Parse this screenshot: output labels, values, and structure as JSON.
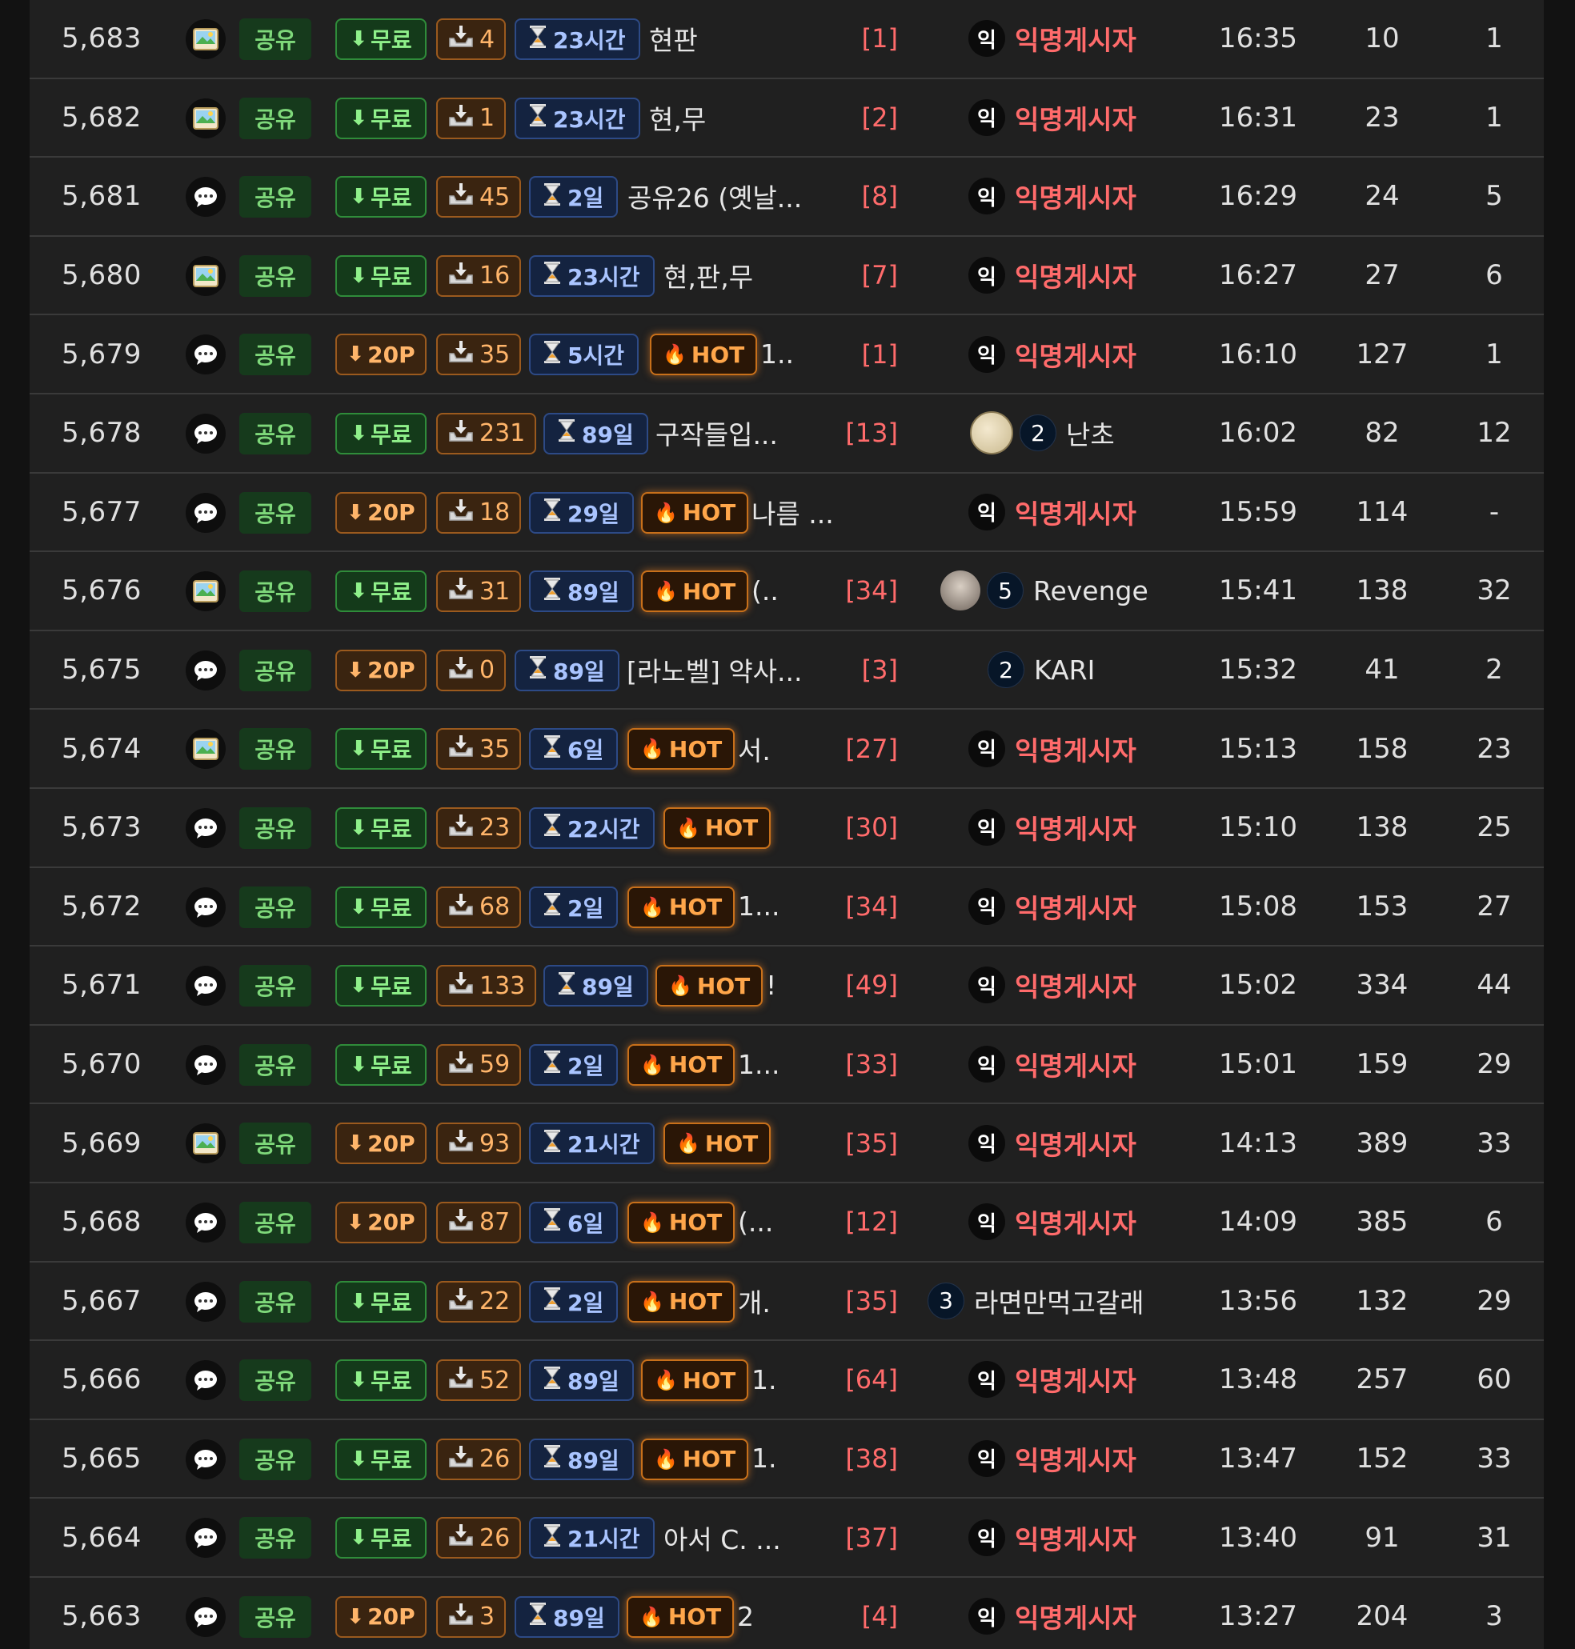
{
  "icons": {
    "image": "image-icon",
    "comment": "speech-bubble-icon",
    "download": "arrow-down-icon",
    "tray": "download-tray-icon",
    "timer": "hourglass-icon",
    "fire": "fire-icon"
  },
  "colors": {
    "free": "#8ff08a",
    "paid": "#ffb56a",
    "time": "#a9c4ff",
    "hot": "#ffa64a",
    "comment_count": "#ff6b6b",
    "anon": "#ff6b6b"
  },
  "hot_label": "HOT",
  "anon_badge": "익",
  "rows": [
    {
      "num": "5,683",
      "type": "image",
      "cat": "공유",
      "price": "무료",
      "free": true,
      "dl": "4",
      "time": "23시간",
      "hot": false,
      "title": "현판",
      "cmt": "[1]",
      "author": {
        "kind": "anon",
        "name": "익명게시자"
      },
      "date": "16:35",
      "views": "10",
      "likes": "1"
    },
    {
      "num": "5,682",
      "type": "image",
      "cat": "공유",
      "price": "무료",
      "free": true,
      "dl": "1",
      "time": "23시간",
      "hot": false,
      "title": "현,무",
      "cmt": "[2]",
      "author": {
        "kind": "anon",
        "name": "익명게시자"
      },
      "date": "16:31",
      "views": "23",
      "likes": "1"
    },
    {
      "num": "5,681",
      "type": "comment",
      "cat": "공유",
      "price": "무료",
      "free": true,
      "dl": "45",
      "time": "2일",
      "hot": false,
      "title": "공유26 (옛날...",
      "cmt": "[8]",
      "author": {
        "kind": "anon",
        "name": "익명게시자"
      },
      "date": "16:29",
      "views": "24",
      "likes": "5"
    },
    {
      "num": "5,680",
      "type": "image",
      "cat": "공유",
      "price": "무료",
      "free": true,
      "dl": "16",
      "time": "23시간",
      "hot": false,
      "title": "현,판,무",
      "cmt": "[7]",
      "author": {
        "kind": "anon",
        "name": "익명게시자"
      },
      "date": "16:27",
      "views": "27",
      "likes": "6"
    },
    {
      "num": "5,679",
      "type": "comment",
      "cat": "공유",
      "price": "20P",
      "free": false,
      "dl": "35",
      "time": "5시간",
      "hot": true,
      "title": "1..",
      "cmt": "[1]",
      "author": {
        "kind": "anon",
        "name": "익명게시자"
      },
      "date": "16:10",
      "views": "127",
      "likes": "1"
    },
    {
      "num": "5,678",
      "type": "comment",
      "cat": "공유",
      "price": "무료",
      "free": true,
      "dl": "231",
      "time": "89일",
      "hot": false,
      "title": "구작들입...",
      "cmt": "[13]",
      "author": {
        "kind": "user",
        "level": "2",
        "name": "난초",
        "avatar": "beige"
      },
      "date": "16:02",
      "views": "82",
      "likes": "12"
    },
    {
      "num": "5,677",
      "type": "comment",
      "cat": "공유",
      "price": "20P",
      "free": false,
      "dl": "18",
      "time": "29일",
      "hot": true,
      "title": "나름 ...",
      "cmt": "",
      "author": {
        "kind": "anon",
        "name": "익명게시자"
      },
      "date": "15:59",
      "views": "114",
      "likes": "-"
    },
    {
      "num": "5,676",
      "type": "image",
      "cat": "공유",
      "price": "무료",
      "free": true,
      "dl": "31",
      "time": "89일",
      "hot": true,
      "title": "(..",
      "cmt": "[34]",
      "author": {
        "kind": "user",
        "level": "5",
        "name": "Revenge",
        "avatar": "grey"
      },
      "date": "15:41",
      "views": "138",
      "likes": "32"
    },
    {
      "num": "5,675",
      "type": "comment",
      "cat": "공유",
      "price": "20P",
      "free": false,
      "dl": "0",
      "time": "89일",
      "hot": false,
      "title": "[라노벨] 약사...",
      "cmt": "[3]",
      "author": {
        "kind": "user",
        "level": "2",
        "name": "KARI",
        "avatar": ""
      },
      "date": "15:32",
      "views": "41",
      "likes": "2"
    },
    {
      "num": "5,674",
      "type": "image",
      "cat": "공유",
      "price": "무료",
      "free": true,
      "dl": "35",
      "time": "6일",
      "hot": true,
      "title": "서.",
      "cmt": "[27]",
      "author": {
        "kind": "anon",
        "name": "익명게시자"
      },
      "date": "15:13",
      "views": "158",
      "likes": "23"
    },
    {
      "num": "5,673",
      "type": "comment",
      "cat": "공유",
      "price": "무료",
      "free": true,
      "dl": "23",
      "time": "22시간",
      "hot": true,
      "title": "",
      "cmt": "[30]",
      "author": {
        "kind": "anon",
        "name": "익명게시자"
      },
      "date": "15:10",
      "views": "138",
      "likes": "25"
    },
    {
      "num": "5,672",
      "type": "comment",
      "cat": "공유",
      "price": "무료",
      "free": true,
      "dl": "68",
      "time": "2일",
      "hot": true,
      "title": "1...",
      "cmt": "[34]",
      "author": {
        "kind": "anon",
        "name": "익명게시자"
      },
      "date": "15:08",
      "views": "153",
      "likes": "27"
    },
    {
      "num": "5,671",
      "type": "comment",
      "cat": "공유",
      "price": "무료",
      "free": true,
      "dl": "133",
      "time": "89일",
      "hot": true,
      "title": "!",
      "cmt": "[49]",
      "author": {
        "kind": "anon",
        "name": "익명게시자"
      },
      "date": "15:02",
      "views": "334",
      "likes": "44"
    },
    {
      "num": "5,670",
      "type": "comment",
      "cat": "공유",
      "price": "무료",
      "free": true,
      "dl": "59",
      "time": "2일",
      "hot": true,
      "title": "1...",
      "cmt": "[33]",
      "author": {
        "kind": "anon",
        "name": "익명게시자"
      },
      "date": "15:01",
      "views": "159",
      "likes": "29"
    },
    {
      "num": "5,669",
      "type": "image",
      "cat": "공유",
      "price": "20P",
      "free": false,
      "dl": "93",
      "time": "21시간",
      "hot": true,
      "title": "",
      "cmt": "[35]",
      "author": {
        "kind": "anon",
        "name": "익명게시자"
      },
      "date": "14:13",
      "views": "389",
      "likes": "33"
    },
    {
      "num": "5,668",
      "type": "comment",
      "cat": "공유",
      "price": "20P",
      "free": false,
      "dl": "87",
      "time": "6일",
      "hot": true,
      "title": "(...",
      "cmt": "[12]",
      "author": {
        "kind": "anon",
        "name": "익명게시자"
      },
      "date": "14:09",
      "views": "385",
      "likes": "6"
    },
    {
      "num": "5,667",
      "type": "comment",
      "cat": "공유",
      "price": "무료",
      "free": true,
      "dl": "22",
      "time": "2일",
      "hot": true,
      "title": "개.",
      "cmt": "[35]",
      "author": {
        "kind": "user",
        "level": "3",
        "name": "라면만먹고갈래",
        "avatar": ""
      },
      "date": "13:56",
      "views": "132",
      "likes": "29"
    },
    {
      "num": "5,666",
      "type": "comment",
      "cat": "공유",
      "price": "무료",
      "free": true,
      "dl": "52",
      "time": "89일",
      "hot": true,
      "title": "1.",
      "cmt": "[64]",
      "author": {
        "kind": "anon",
        "name": "익명게시자"
      },
      "date": "13:48",
      "views": "257",
      "likes": "60"
    },
    {
      "num": "5,665",
      "type": "comment",
      "cat": "공유",
      "price": "무료",
      "free": true,
      "dl": "26",
      "time": "89일",
      "hot": true,
      "title": "1.",
      "cmt": "[38]",
      "author": {
        "kind": "anon",
        "name": "익명게시자"
      },
      "date": "13:47",
      "views": "152",
      "likes": "33"
    },
    {
      "num": "5,664",
      "type": "comment",
      "cat": "공유",
      "price": "무료",
      "free": true,
      "dl": "26",
      "time": "21시간",
      "hot": false,
      "title": "아서 C. ...",
      "cmt": "[37]",
      "author": {
        "kind": "anon",
        "name": "익명게시자"
      },
      "date": "13:40",
      "views": "91",
      "likes": "31"
    },
    {
      "num": "5,663",
      "type": "comment",
      "cat": "공유",
      "price": "20P",
      "free": false,
      "dl": "3",
      "time": "89일",
      "hot": true,
      "title": "2",
      "cmt": "[4]",
      "author": {
        "kind": "anon",
        "name": "익명게시자"
      },
      "date": "13:27",
      "views": "204",
      "likes": "3"
    }
  ]
}
